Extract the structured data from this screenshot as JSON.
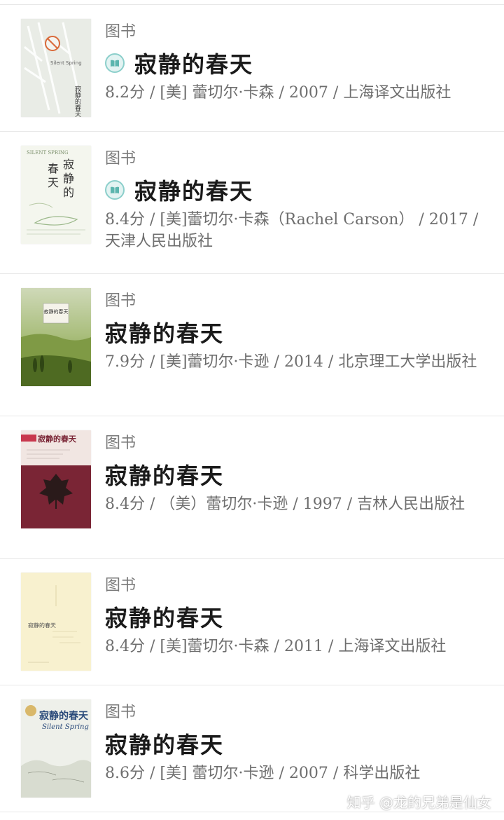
{
  "results": [
    {
      "category": "图书",
      "title": "寂静的春天",
      "has_read_icon": true,
      "meta": "8.2分 / [美] 蕾切尔·卡森 / 2007 / 上海译文出版社",
      "cover": {
        "title_text": "寂静的春天",
        "subtitle_text": "Silent Spring"
      }
    },
    {
      "category": "图书",
      "title": "寂静的春天",
      "has_read_icon": true,
      "meta": "8.4分 / [美]蕾切尔·卡森（Rachel Carson） / 2017 / 天津人民出版社",
      "cover": {
        "title_text": "寂静的春天",
        "subtitle_text": "SILENT SPRING"
      }
    },
    {
      "category": "图书",
      "title": "寂静的春天",
      "has_read_icon": false,
      "meta": "7.9分 / [美]蕾切尔·卡逊 / 2014 / 北京理工大学出版社",
      "cover": {
        "title_text": "寂静的春天",
        "subtitle_text": ""
      }
    },
    {
      "category": "图书",
      "title": "寂静的春天",
      "has_read_icon": false,
      "meta": "8.4分 / （美）蕾切尔·卡逊 / 1997 / 吉林人民出版社",
      "cover": {
        "title_text": "寂静的春天",
        "subtitle_text": ""
      }
    },
    {
      "category": "图书",
      "title": "寂静的春天",
      "has_read_icon": false,
      "meta": "8.4分 / [美]蕾切尔·卡森 / 2011 / 上海译文出版社",
      "cover": {
        "title_text": "寂静的春天",
        "subtitle_text": ""
      }
    },
    {
      "category": "图书",
      "title": "寂静的春天",
      "has_read_icon": false,
      "meta": "8.6分 / [美] 蕾切尔·卡逊 / 2007 / 科学出版社",
      "cover": {
        "title_text": "寂静的春天",
        "subtitle_text": "Silent Spring"
      }
    }
  ],
  "watermark": "知乎 @龙的兄弟是仙女",
  "colors": {
    "accent_icon": "#8ccfcb",
    "divider": "#e8e8e8",
    "meta_text": "#6e6e6e"
  },
  "icons": {
    "read": "open-book-icon"
  }
}
